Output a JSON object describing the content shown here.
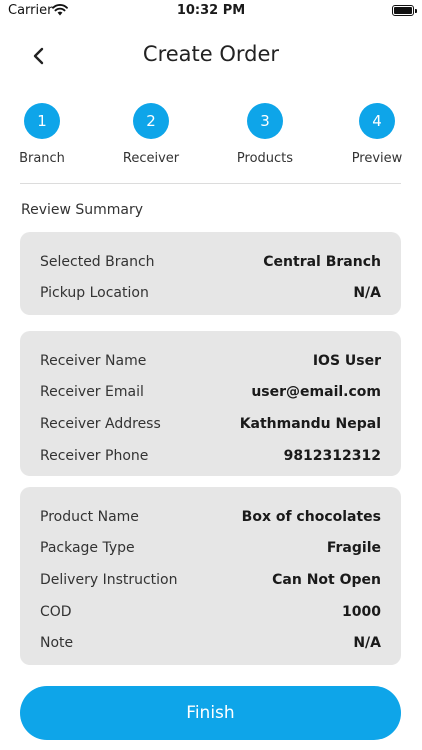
{
  "status_bar": {
    "carrier": "Carrier",
    "time": "10:32 PM"
  },
  "header": {
    "title": "Create Order",
    "back_icon": "chevron-left-icon"
  },
  "steps": [
    {
      "number": "1",
      "label": "Branch"
    },
    {
      "number": "2",
      "label": "Receiver"
    },
    {
      "number": "3",
      "label": "Products"
    },
    {
      "number": "4",
      "label": "Preview"
    }
  ],
  "review": {
    "title": "Review Summary",
    "branch_card": [
      {
        "label": "Selected Branch",
        "value": "Central Branch"
      },
      {
        "label": "Pickup Location",
        "value": "N/A"
      }
    ],
    "receiver_card": [
      {
        "label": "Receiver Name",
        "value": "IOS User"
      },
      {
        "label": "Receiver Email",
        "value": "user@email.com"
      },
      {
        "label": "Receiver Address",
        "value": "Kathmandu Nepal"
      },
      {
        "label": "Receiver Phone",
        "value": "9812312312"
      }
    ],
    "product_card": [
      {
        "label": "Product Name",
        "value": "Box of chocolates"
      },
      {
        "label": "Package Type",
        "value": "Fragile"
      },
      {
        "label": "Delivery Instruction",
        "value": "Can Not Open"
      },
      {
        "label": "COD",
        "value": "1000"
      },
      {
        "label": "Note",
        "value": "N/A"
      }
    ]
  },
  "finish_label": "Finish",
  "colors": {
    "accent": "#0ea5e9",
    "card_bg": "#e6e6e6"
  }
}
